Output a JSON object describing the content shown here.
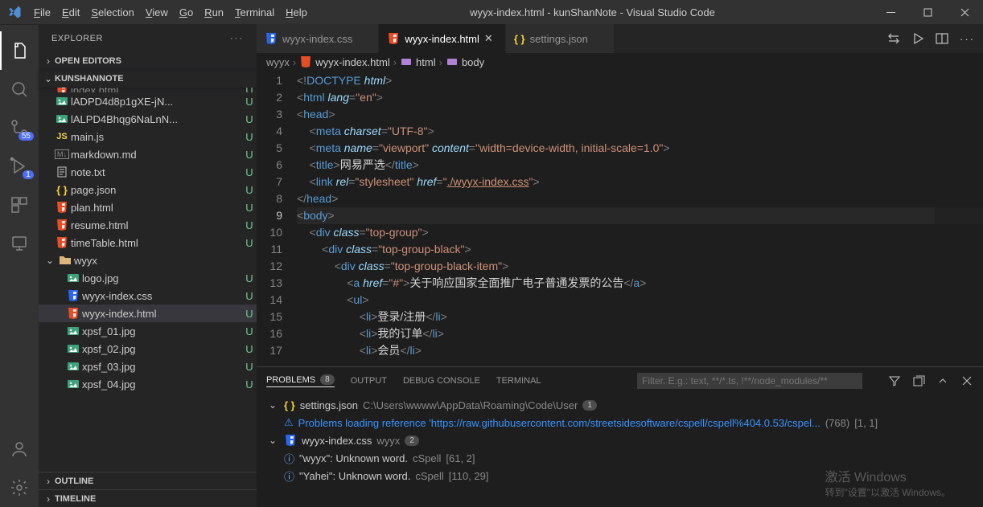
{
  "titlebar": {
    "menu": [
      {
        "label": "File",
        "u": "F"
      },
      {
        "label": "Edit",
        "u": "E"
      },
      {
        "label": "Selection",
        "u": "S"
      },
      {
        "label": "View",
        "u": "V"
      },
      {
        "label": "Go",
        "u": "G"
      },
      {
        "label": "Run",
        "u": "R"
      },
      {
        "label": "Terminal",
        "u": "T"
      },
      {
        "label": "Help",
        "u": "H"
      }
    ],
    "title": "wyyx-index.html - kunShanNote - Visual Studio Code"
  },
  "activity": {
    "scm_badge": "55",
    "debug_badge": "1"
  },
  "sidebar": {
    "title": "EXPLORER",
    "sections": {
      "open_editors": "OPEN EDITORS",
      "workspace": "KUNSHANNOTE",
      "outline": "OUTLINE",
      "timeline": "TIMELINE"
    },
    "files": [
      {
        "name": "index.html",
        "icon": "html5",
        "status": "U",
        "cut": true
      },
      {
        "name": "lADPD4d8p1gXE-jN...",
        "icon": "img",
        "status": "U"
      },
      {
        "name": "lALPD4Bhqg6NaLnN...",
        "icon": "img",
        "status": "U"
      },
      {
        "name": "main.js",
        "icon": "js",
        "status": "U"
      },
      {
        "name": "markdown.md",
        "icon": "md",
        "status": "U"
      },
      {
        "name": "note.txt",
        "icon": "txt",
        "status": "U"
      },
      {
        "name": "page.json",
        "icon": "json",
        "status": "U"
      },
      {
        "name": "plan.html",
        "icon": "html5",
        "status": "U"
      },
      {
        "name": "resume.html",
        "icon": "html5",
        "status": "U"
      },
      {
        "name": "timeTable.html",
        "icon": "html5",
        "status": "U"
      }
    ],
    "folder": {
      "name": "wyyx",
      "status": "dot"
    },
    "folder_files": [
      {
        "name": "logo.jpg",
        "icon": "img",
        "status": "U"
      },
      {
        "name": "wyyx-index.css",
        "icon": "css3",
        "status": "U"
      },
      {
        "name": "wyyx-index.html",
        "icon": "html5",
        "status": "U",
        "active": true
      },
      {
        "name": "xpsf_01.jpg",
        "icon": "img",
        "status": "U"
      },
      {
        "name": "xpsf_02.jpg",
        "icon": "img",
        "status": "U"
      },
      {
        "name": "xpsf_03.jpg",
        "icon": "img",
        "status": "U"
      },
      {
        "name": "xpsf_04.jpg",
        "icon": "img",
        "status": "U"
      }
    ]
  },
  "tabs": [
    {
      "label": "wyyx-index.css",
      "icon": "css3",
      "active": false
    },
    {
      "label": "wyyx-index.html",
      "icon": "html5",
      "active": true
    },
    {
      "label": "settings.json",
      "icon": "json",
      "active": false
    }
  ],
  "breadcrumbs": {
    "parts": [
      "wyyx",
      "wyyx-index.html",
      "html",
      "body"
    ]
  },
  "editor": {
    "line_start": 1,
    "line_end": 17,
    "current_line": 9,
    "text": {
      "title_text": "网易严选",
      "stylesheet_href": "./wyyx-index.css",
      "a_text": "关于响应国家全面推广电子普通发票的公告",
      "li1": "登录/注册",
      "li2": "我的订单",
      "li3": "会员"
    }
  },
  "panel": {
    "tabs": {
      "problems": "PROBLEMS",
      "problems_count": "8",
      "output": "OUTPUT",
      "debug_console": "DEBUG CONSOLE",
      "terminal": "TERMINAL"
    },
    "filter_placeholder": "Filter. E.g.: text, **/*.ts, !**/node_modules/**",
    "groups": [
      {
        "file": "settings.json",
        "path": "C:\\Users\\wwww\\AppData\\Roaming\\Code\\User",
        "count": "1",
        "items": [
          {
            "msg": "Problems loading reference 'https://raw.githubusercontent.com/streetsidesoftware/cspell/cspell%404.0.53/cspel...",
            "code": "(768)",
            "loc": "[1, 1]",
            "type": "warn"
          }
        ]
      },
      {
        "file": "wyyx-index.css",
        "path": "wyyx",
        "count": "2",
        "items": [
          {
            "msg": "\"wyyx\": Unknown word.",
            "code": "cSpell",
            "loc": "[61, 2]",
            "type": "info"
          },
          {
            "msg": "\"Yahei\": Unknown word.",
            "code": "cSpell",
            "loc": "[110, 29]",
            "type": "info"
          }
        ]
      }
    ]
  },
  "watermark": {
    "line1": "激活 Windows",
    "line2": "转到\"设置\"以激活 Windows。"
  }
}
